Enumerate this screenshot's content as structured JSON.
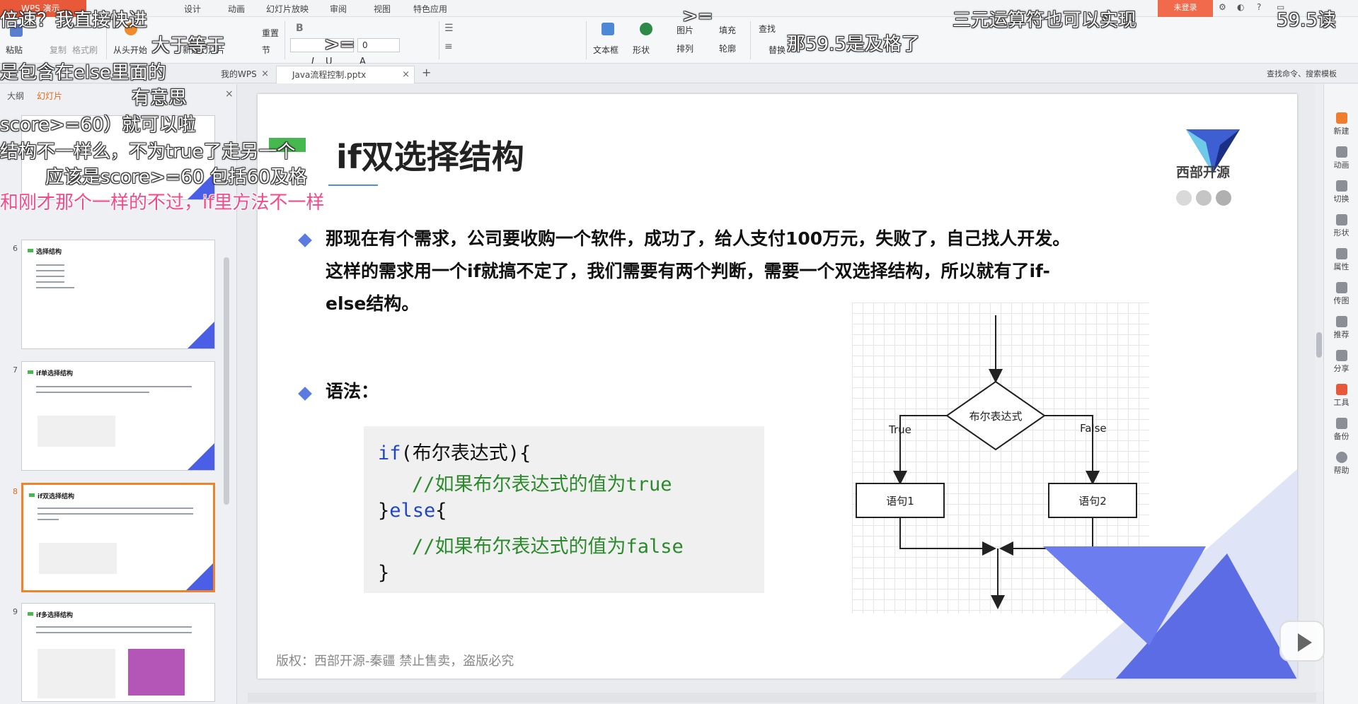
{
  "app": {
    "badge": "WPS 演示",
    "login": "未登录"
  },
  "menu": [
    "设计",
    "动画",
    "幻灯片放映",
    "审阅",
    "视图",
    "特色应用"
  ],
  "ribbon": {
    "paste": "粘贴",
    "copy": "复制",
    "format_painter": "格式刷",
    "from_start": "从头开始",
    "new_slide": "新建幻灯片",
    "reset": "重置",
    "section": "节",
    "font_size": "0",
    "textbox": "文本框",
    "shape": "形状",
    "picture": "图片",
    "fill": "填充",
    "arrange": "排列",
    "outline": "轮廓",
    "find": "查找",
    "replace": "替换"
  },
  "tabs": {
    "doc1": "我的WPS",
    "doc2": "Java流程控制.pptx",
    "add": "+",
    "search": "查找命令、搜索模板"
  },
  "left_pane": {
    "tab_outline": "大纲",
    "tab_slides": "幻灯片",
    "thumbs": [
      {
        "num": "6",
        "title": "选择结构"
      },
      {
        "num": "7",
        "title": "if单选择结构"
      },
      {
        "num": "8",
        "title": "if双选择结构"
      },
      {
        "num": "9",
        "title": "if多选择结构"
      }
    ]
  },
  "slide": {
    "title": "if双选择结构",
    "para1": "那现在有个需求，公司要收购一个软件，成功了，给人支付100万元，失败了，自己找人开发。",
    "para2": "这样的需求用一个if就搞不定了，我们需要有两个判断，需要一个双选择结构，所以就有了if-",
    "para3": "else结构。",
    "syntax_label": "语法：",
    "code": {
      "l1_kw": "if",
      "l1_tx": "(布尔表达式){",
      "l2": "//如果布尔表达式的值为true",
      "l3_tx1": "}",
      "l3_kw": "else",
      "l3_tx2": "{",
      "l4": "//如果布尔表达式的值为false",
      "l5": "}"
    },
    "footer": "版权：西部开源-秦疆    禁止售卖，盗版必究",
    "logo_text": "西部开源",
    "flowchart": {
      "decision": "布尔表达式",
      "true_label": "True",
      "false_label": "False",
      "stmt1": "语句1",
      "stmt2": "语句2"
    }
  },
  "right_sidebar": [
    "新建",
    "动画",
    "切换",
    "形状",
    "属性",
    "传图",
    "推荐",
    "分享",
    "工具",
    "备份",
    "帮助"
  ],
  "danmaku": [
    "倍速？我直接快进",
    "大于等于",
    "是包含在else里面的",
    "有意思",
    "score>=60）就可以啦",
    "结构不一样么，不为true了走另一个",
    "应该是score>=60 包括60及格",
    "和刚才那个一样的不过，if里方法不一样",
    ">=",
    "三元运算符也可以实现",
    "那59.5是及格了",
    "59.5读",
    ">="
  ]
}
